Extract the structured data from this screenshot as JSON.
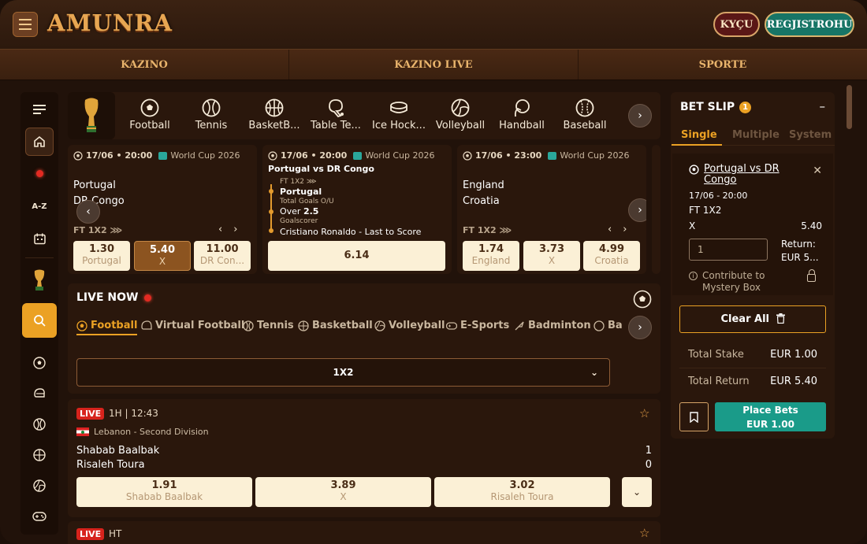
{
  "header": {
    "logo_text": "AMUNRA",
    "login_label": "KYÇU",
    "register_label": "REGJISTROHU"
  },
  "nav": [
    "KAZINO",
    "KAZINO LIVE",
    "SPORTE"
  ],
  "sidebar": {
    "items": [
      "menu",
      "home",
      "live",
      "A-Z",
      "calendar",
      "world-cup",
      "search",
      "football",
      "american-football",
      "tennis",
      "basketball",
      "volleyball",
      "esports"
    ],
    "az_label": "A-Z"
  },
  "sports_tabs": [
    "Football",
    "Tennis",
    "BasketB...",
    "Table Te...",
    "Ice Hock...",
    "Volleyball",
    "Handball",
    "Baseball"
  ],
  "cards": [
    {
      "date": "17/06 • 20:00",
      "competition": "World Cup 2026",
      "home": "Portugal",
      "away": "DR Congo",
      "market": "FT 1X2",
      "odds": [
        {
          "value": "1.30",
          "label": "Portugal"
        },
        {
          "value": "5.40",
          "label": "X"
        },
        {
          "value": "11.00",
          "label": "DR Con..."
        }
      ]
    },
    {
      "date": "17/06 • 20:00",
      "competition": "World Cup 2026",
      "title": "Portugal vs DR Congo",
      "l1": "FT 1X2",
      "s1": "Portugal",
      "l2": "Total Goals O/U",
      "s2_prefix": "Over ",
      "s2_value": "2.5",
      "l3": "Goalscorer",
      "s3": "Cristiano Ronaldo - Last to Score",
      "odd": "6.14"
    },
    {
      "date": "17/06 • 23:00",
      "competition": "World Cup 2026",
      "home": "England",
      "away": "Croatia",
      "market": "FT 1X2",
      "odds": [
        {
          "value": "1.74",
          "label": "England"
        },
        {
          "value": "3.73",
          "label": "X"
        },
        {
          "value": "4.99",
          "label": "Croatia"
        }
      ]
    }
  ],
  "live": {
    "title": "LIVE NOW",
    "tabs": [
      "Football",
      "Virtual Football",
      "Tennis",
      "Basketball",
      "Volleyball",
      "E-Sports",
      "Badminton",
      "Ba"
    ],
    "market_select": "1X2",
    "match1": {
      "badge": "LIVE",
      "time": "1H | 12:43",
      "league": "Lebanon - Second Division",
      "home": "Shabab Baalbak",
      "away": "Risaleh Toura",
      "home_score": "1",
      "away_score": "0",
      "odds": [
        {
          "value": "1.91",
          "label": "Shabab Baalbak"
        },
        {
          "value": "3.89",
          "label": "X"
        },
        {
          "value": "3.02",
          "label": "Risaleh Toura"
        }
      ]
    },
    "match2": {
      "badge": "LIVE",
      "time": "HT"
    }
  },
  "betslip": {
    "title": "BET SLIP",
    "count": "1",
    "tabs": [
      "Single",
      "Multiple",
      "System"
    ],
    "selection": {
      "match": "Portugal vs DR Congo",
      "datetime": "17/06 - 20:00",
      "market": "FT 1X2",
      "pick": "X",
      "odd": "5.40",
      "stake": "1",
      "return_label": "Return:",
      "return_value": "EUR 5..."
    },
    "mystery": "Contribute to Mystery Box",
    "clear_all": "Clear All",
    "total_stake_label": "Total Stake",
    "total_stake": "EUR 1.00",
    "total_return_label": "Total Return",
    "total_return": "EUR 5.40",
    "place_label": "Place Bets",
    "place_amount": "EUR 1.00"
  },
  "colors": {
    "accent": "#eba124",
    "brand_teal": "#1a9b89",
    "live_red": "#d7231c"
  }
}
